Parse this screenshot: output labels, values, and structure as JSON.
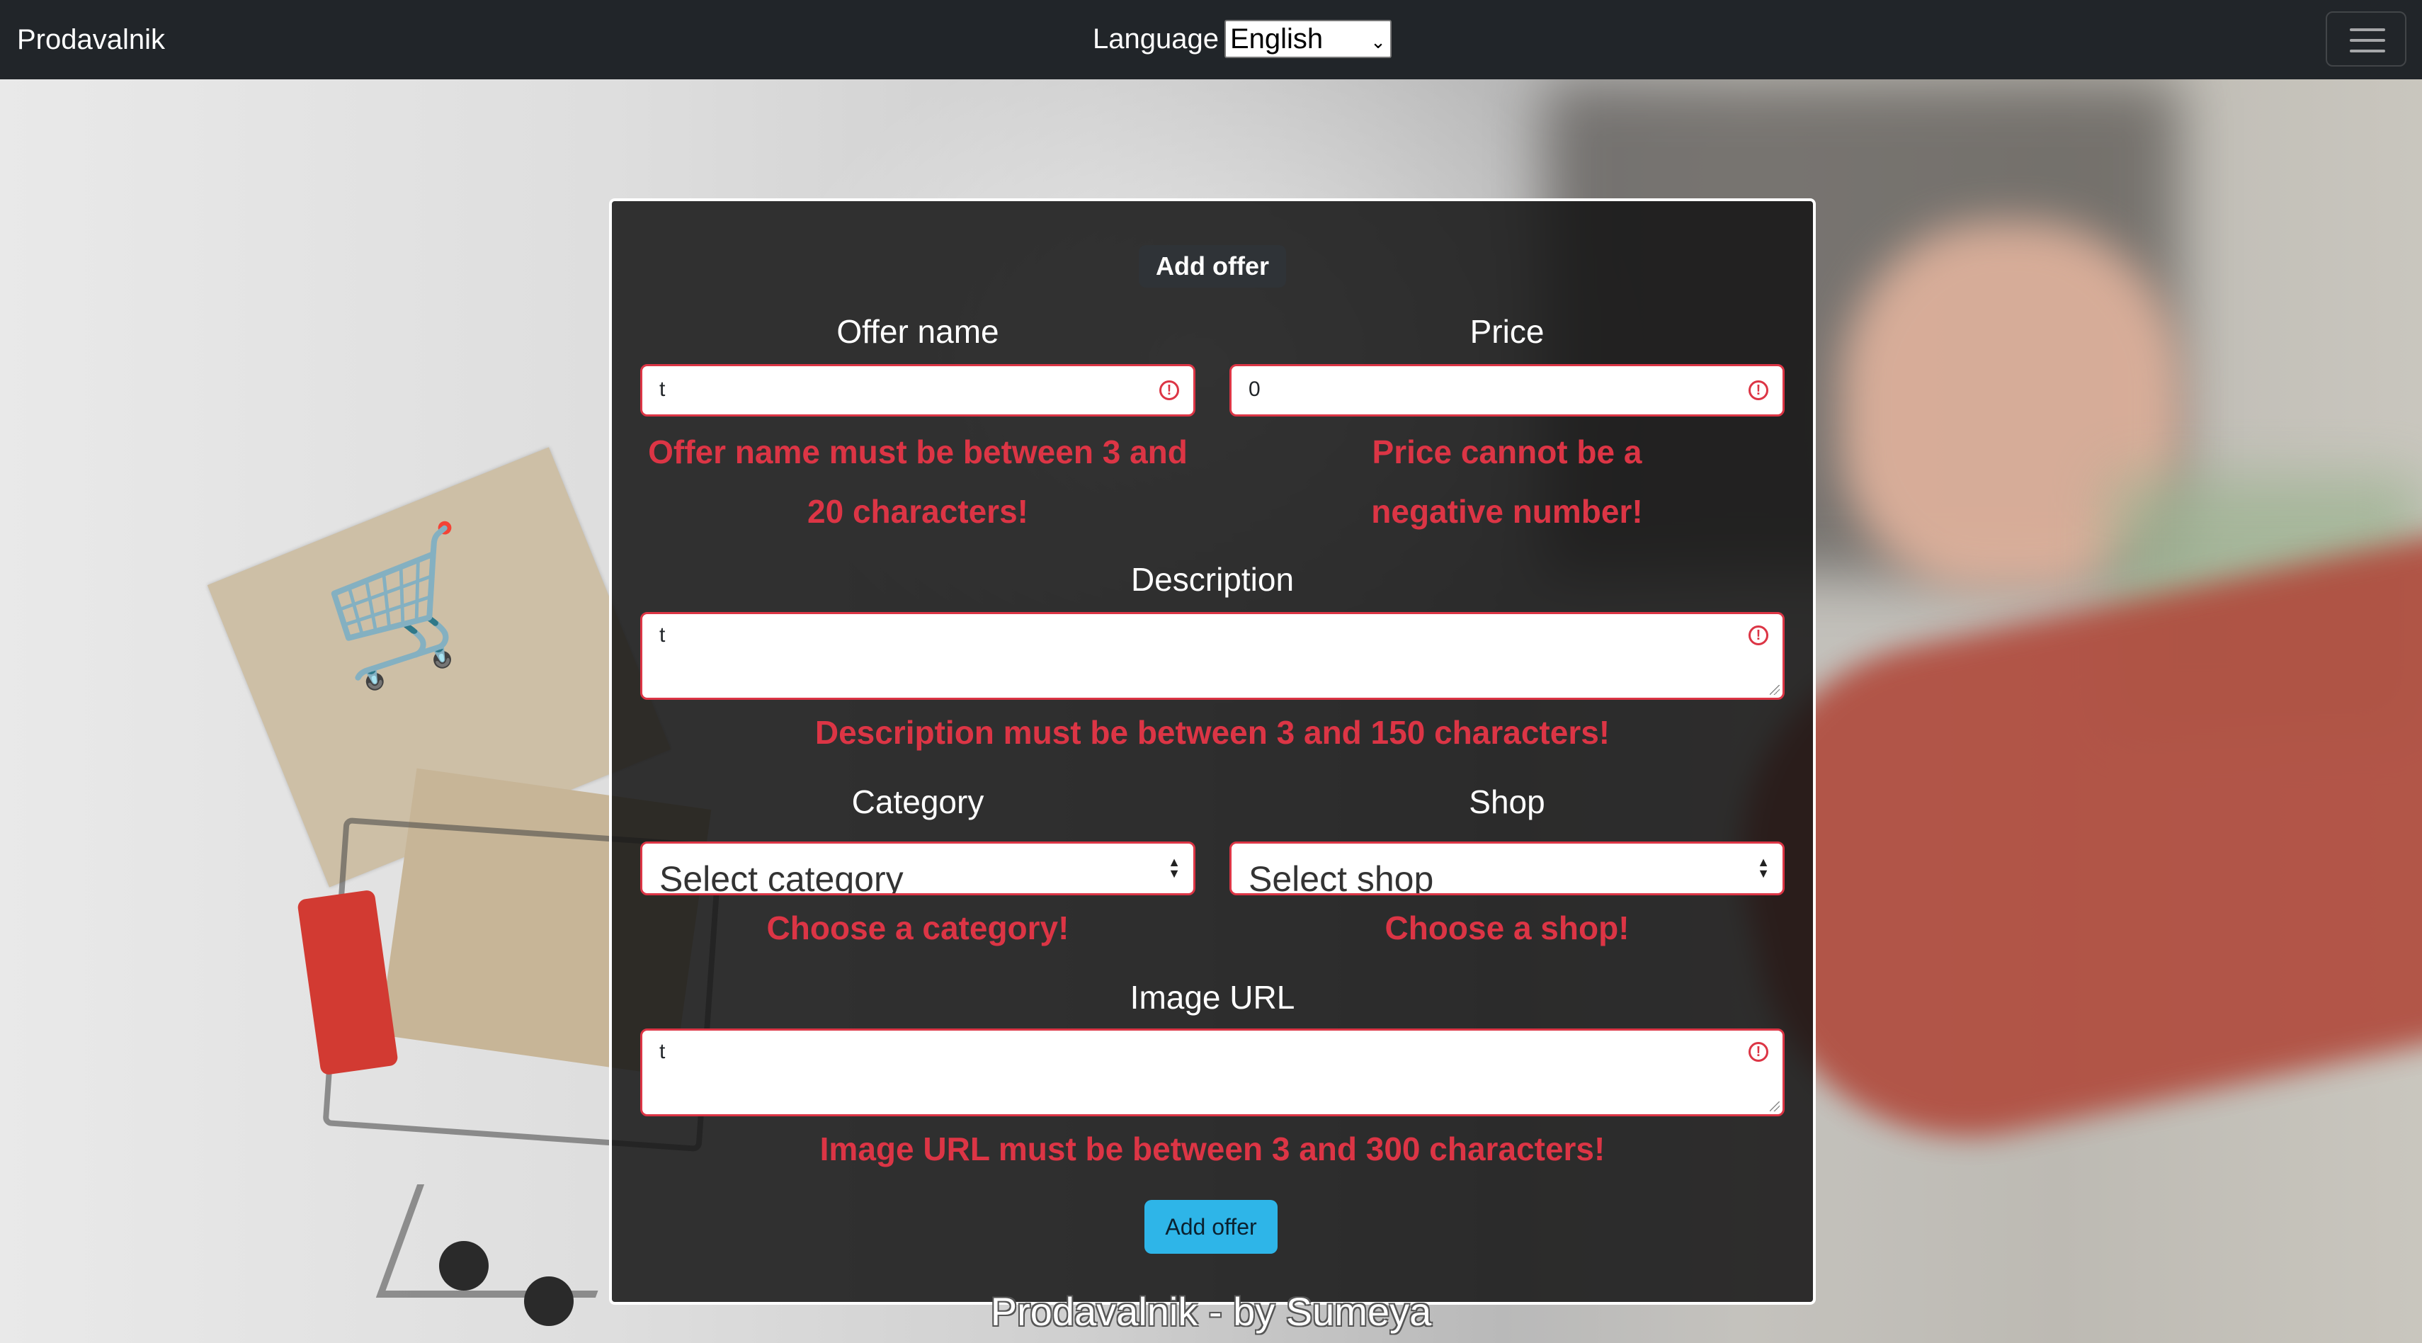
{
  "navbar": {
    "brand": "Prodavalnik",
    "language_label": "Language",
    "language_selected": "English"
  },
  "form": {
    "title": "Add offer",
    "offer_name": {
      "label": "Offer name",
      "value": "t",
      "error": "Offer name must be between 3 and 20 characters!"
    },
    "price": {
      "label": "Price",
      "value": "0",
      "error": "Price cannot be a negative number!"
    },
    "description": {
      "label": "Description",
      "value": "t",
      "error": "Description must be between 3 and 150 characters!"
    },
    "category": {
      "label": "Category",
      "selected": "Select category",
      "error": "Choose a category!"
    },
    "shop": {
      "label": "Shop",
      "selected": "Select shop",
      "error": "Choose a shop!"
    },
    "image_url": {
      "label": "Image URL",
      "value": "t",
      "error": "Image URL must be between 3 and 300 characters!"
    },
    "submit_label": "Add offer"
  },
  "footer": {
    "text": "Prodavalnik - by Sumeya"
  },
  "colors": {
    "navbar_bg": "#212529",
    "error": "#dc3545",
    "submit_bg": "#2eb5e8",
    "card_bg": "#141414"
  },
  "icons": {
    "invalid": "exclamation-circle-icon",
    "menu": "hamburger-menu-icon",
    "select_arrow": "chevron-down-icon",
    "sort_arrows": "caret-up-down-icon"
  }
}
